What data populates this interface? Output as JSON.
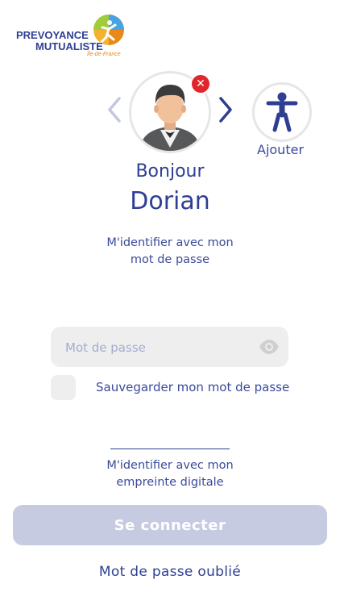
{
  "brand": {
    "line1": "PREVOYANCE",
    "line2": "MUTUALISTE",
    "sub": "Île-de-France"
  },
  "profile": {
    "greeting": "Bonjour",
    "name": "Dorian"
  },
  "add_account": {
    "label": "Ajouter"
  },
  "links": {
    "password_login": "M'identifier avec mon mot de passe",
    "fingerprint_login": "M'identifier avec mon empreinte digitale",
    "forgot_password": "Mot de passe oublié"
  },
  "password_field": {
    "placeholder": "Mot de passe",
    "value": ""
  },
  "save_password": {
    "label": "Sauvegarder mon mot de passe",
    "checked": false
  },
  "connect_button": {
    "label": "Se connecter",
    "enabled": false
  },
  "colors": {
    "primary": "#2e3f93",
    "text": "#3a4a9a",
    "accent_orange": "#e8891a",
    "danger": "#e0252b",
    "button_disabled": "#c6cbe2",
    "field_bg": "#eeeeee"
  },
  "icons": {
    "prev": "chevron-left-icon",
    "next": "chevron-right-icon",
    "remove": "close-icon",
    "accessibility": "accessibility-icon",
    "visibility": "eye-icon"
  }
}
